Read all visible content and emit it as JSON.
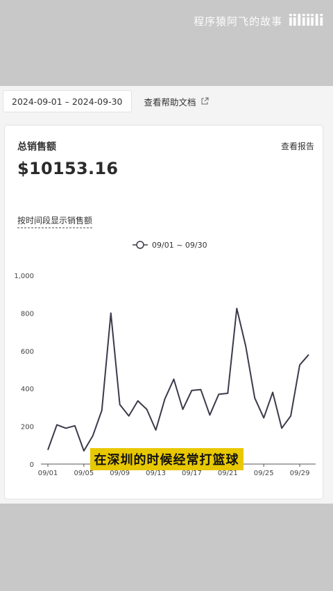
{
  "watermark": {
    "channel": "程序猿阿飞的故事",
    "logo": "bilibili"
  },
  "toolbar": {
    "date_range": "2024-09-01 – 2024-09-30",
    "help_link": "查看帮助文档",
    "help_icon": "external-link-icon"
  },
  "card": {
    "title": "总销售额",
    "view_report": "查看报告",
    "total": "$10153.16",
    "subtitle": "按时间段显示销售额"
  },
  "caption": "在深圳的时候经常打篮球",
  "chart_data": {
    "type": "line",
    "legend": "09/01 ~ 09/30",
    "ylim": [
      0,
      1000
    ],
    "yticks": [
      "0",
      "200",
      "400",
      "600",
      "800",
      "1,000"
    ],
    "xticks": [
      "09/01",
      "09/05",
      "09/09",
      "09/13",
      "09/17",
      "09/21",
      "09/25",
      "09/29"
    ],
    "series": [
      {
        "name": "09/01 ~ 09/30",
        "values": [
          75,
          208,
          190,
          203,
          70,
          150,
          285,
          800,
          315,
          255,
          335,
          290,
          180,
          345,
          450,
          290,
          390,
          395,
          260,
          370,
          375,
          825,
          625,
          350,
          245,
          380,
          190,
          255,
          525,
          580
        ]
      }
    ],
    "color": "#3a3a4a"
  }
}
